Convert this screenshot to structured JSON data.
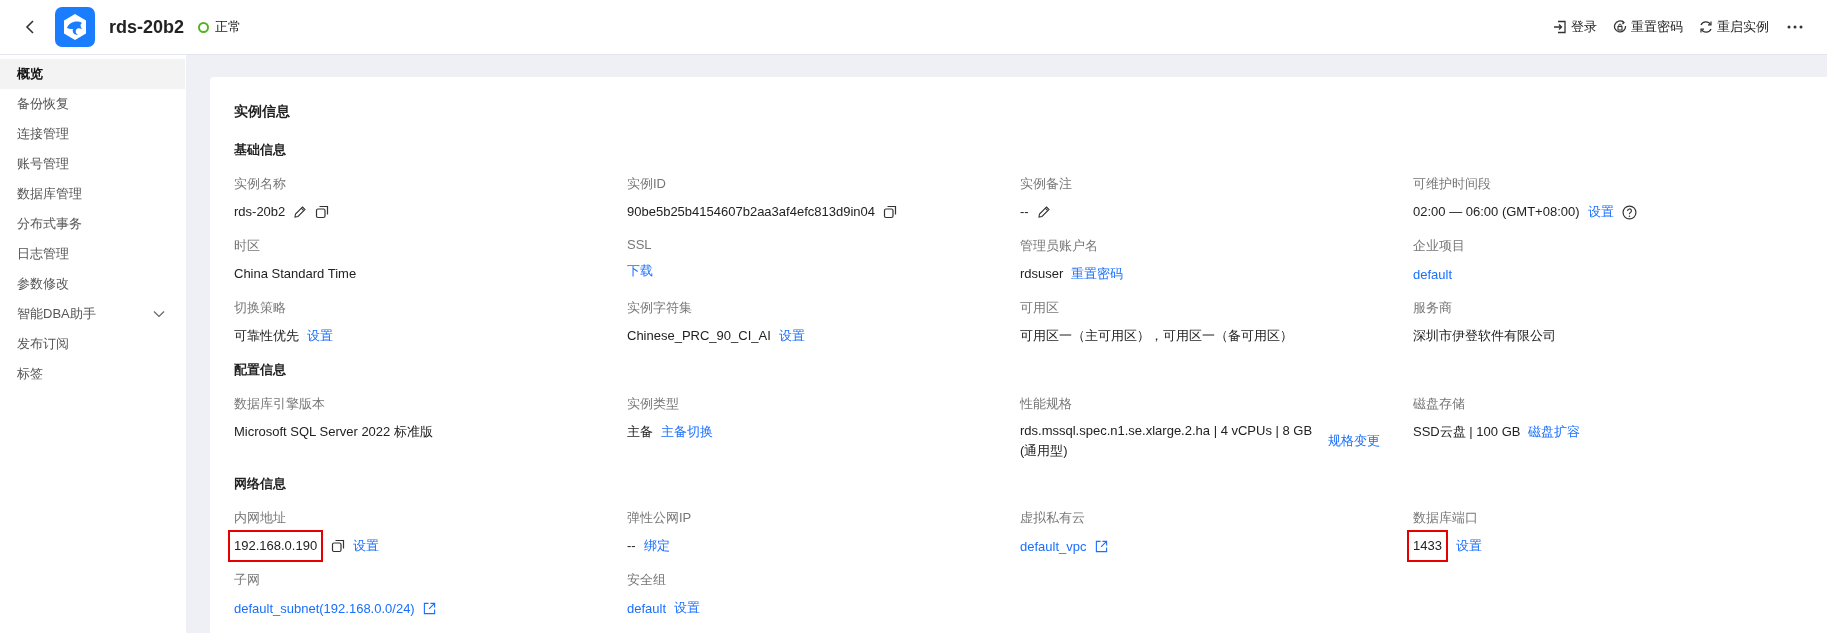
{
  "header": {
    "title": "rds-20b2",
    "status": "正常",
    "actions": [
      {
        "kind": "login",
        "label": "登录"
      },
      {
        "kind": "reset",
        "label": "重置密码"
      },
      {
        "kind": "restart",
        "label": "重启实例"
      },
      {
        "kind": "more"
      }
    ]
  },
  "sidebar": {
    "items": [
      {
        "label": "概览",
        "selected": true
      },
      {
        "label": "备份恢复",
        "selected": false
      },
      {
        "label": "连接管理",
        "selected": false
      },
      {
        "label": "账号管理",
        "selected": false
      },
      {
        "label": "数据库管理",
        "selected": false
      },
      {
        "label": "分布式事务",
        "selected": false
      },
      {
        "label": "日志管理",
        "selected": false
      },
      {
        "label": "参数修改",
        "selected": false
      },
      {
        "label": "智能DBA助手",
        "selected": false,
        "expanded": false
      },
      {
        "label": "发布订阅",
        "selected": false
      },
      {
        "label": "标签",
        "selected": false
      }
    ]
  },
  "card": {
    "title": "实例信息",
    "sections": [
      {
        "title": "基础信息",
        "fields": [
          {
            "label": "实例名称",
            "parts": [
              {
                "kind": "text",
                "text": "rds-20b2"
              },
              {
                "kind": "edit"
              },
              {
                "kind": "copy"
              }
            ]
          },
          {
            "label": "实例ID",
            "parts": [
              {
                "kind": "text",
                "text": "90be5b25b4154607b2aa3af4efc813d9in04"
              },
              {
                "kind": "copy"
              }
            ]
          },
          {
            "label": "实例备注",
            "parts": [
              {
                "kind": "text",
                "text": "--"
              },
              {
                "kind": "edit"
              }
            ]
          },
          {
            "label": "可维护时间段",
            "parts": [
              {
                "kind": "text",
                "text": "02:00 — 06:00 (GMT+08:00)"
              },
              {
                "kind": "link",
                "text": "设置"
              },
              {
                "kind": "help"
              }
            ]
          },
          {
            "label": "时区",
            "parts": [
              {
                "kind": "text",
                "text": "China Standard Time"
              }
            ]
          },
          {
            "label": "SSL",
            "parts": [
              {
                "kind": "link",
                "text": "下载"
              }
            ]
          },
          {
            "label": "管理员账户名",
            "parts": [
              {
                "kind": "text",
                "text": "rdsuser"
              },
              {
                "kind": "link",
                "text": "重置密码"
              }
            ]
          },
          {
            "label": "企业项目",
            "parts": [
              {
                "kind": "link",
                "text": "default"
              }
            ]
          },
          {
            "label": "切换策略",
            "parts": [
              {
                "kind": "text",
                "text": "可靠性优先"
              },
              {
                "kind": "link",
                "text": "设置"
              }
            ]
          },
          {
            "label": "实例字符集",
            "parts": [
              {
                "kind": "text",
                "text": "Chinese_PRC_90_CI_AI"
              },
              {
                "kind": "link",
                "text": "设置"
              }
            ]
          },
          {
            "label": "可用区",
            "parts": [
              {
                "kind": "text",
                "text": "可用区一（主可用区），可用区一（备可用区）"
              }
            ]
          },
          {
            "label": "服务商",
            "parts": [
              {
                "kind": "text",
                "text": "深圳市伊登软件有限公司"
              }
            ]
          }
        ]
      },
      {
        "title": "配置信息",
        "fields": [
          {
            "label": "数据库引擎版本",
            "parts": [
              {
                "kind": "text",
                "text": "Microsoft SQL Server 2022 标准版"
              }
            ]
          },
          {
            "label": "实例类型",
            "parts": [
              {
                "kind": "text",
                "text": "主备"
              },
              {
                "kind": "link",
                "text": "主备切换"
              }
            ]
          },
          {
            "label": "性能规格",
            "parts": [
              {
                "kind": "text",
                "text": "rds.mssql.spec.n1.se.xlarge.2.ha | 4 vCPUs | 8 GB (通用型)"
              },
              {
                "kind": "link",
                "text": "规格变更"
              }
            ]
          },
          {
            "label": "磁盘存储",
            "parts": [
              {
                "kind": "text",
                "text": "SSD云盘 | 100 GB"
              },
              {
                "kind": "link",
                "text": "磁盘扩容"
              }
            ]
          }
        ]
      },
      {
        "title": "网络信息",
        "fields": [
          {
            "label": "内网地址",
            "parts": [
              {
                "kind": "text",
                "text": "192.168.0.190",
                "highlighted": true
              },
              {
                "kind": "copy"
              },
              {
                "kind": "link",
                "text": "设置"
              }
            ]
          },
          {
            "label": "弹性公网IP",
            "parts": [
              {
                "kind": "text",
                "text": "--"
              },
              {
                "kind": "link",
                "text": "绑定"
              }
            ]
          },
          {
            "label": "虚拟私有云",
            "parts": [
              {
                "kind": "link",
                "text": "default_vpc"
              },
              {
                "kind": "external"
              }
            ]
          },
          {
            "label": "数据库端口",
            "parts": [
              {
                "kind": "text",
                "text": "1433",
                "highlighted": true
              },
              {
                "kind": "link",
                "text": "设置"
              }
            ]
          },
          {
            "label": "子网",
            "parts": [
              {
                "kind": "link",
                "text": "default_subnet(192.168.0.0/24)"
              },
              {
                "kind": "external"
              }
            ]
          },
          {
            "label": "安全组",
            "parts": [
              {
                "kind": "link",
                "text": "default"
              },
              {
                "kind": "link",
                "text": "设置"
              }
            ]
          }
        ]
      }
    ]
  }
}
